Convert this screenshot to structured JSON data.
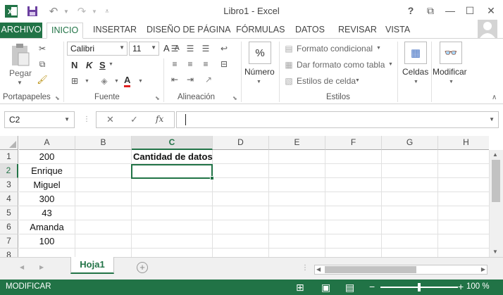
{
  "window": {
    "title": "Libro1 - Excel",
    "buttons": [
      "?",
      "⧉",
      "—",
      "☐",
      "✕"
    ]
  },
  "ribbon_tabs": [
    "ARCHIVO",
    "INICIO",
    "INSERTAR",
    "DISEÑO DE PÁGINA",
    "FÓRMULAS",
    "DATOS",
    "REVISAR",
    "VISTA"
  ],
  "clipboard": {
    "paste_label": "Pegar",
    "group_label": "Portapapeles"
  },
  "font": {
    "name": "Calibri",
    "size": "11",
    "bold": "N",
    "italic": "K",
    "underline": "S",
    "grow": "A",
    "shrink": "A",
    "color_letter": "A",
    "group_label": "Fuente"
  },
  "alignment": {
    "group_label": "Alineación"
  },
  "number": {
    "symbol": "%",
    "label": "Número"
  },
  "styles": {
    "conditional": "Formato condicional",
    "as_table": "Dar formato como tabla",
    "cell_styles": "Estilos de celda",
    "group_label": "Estilos"
  },
  "cells": {
    "label": "Celdas"
  },
  "editing": {
    "label": "Modificar"
  },
  "formula_bar": {
    "name_box": "C2",
    "fx": "fx",
    "value": ""
  },
  "grid": {
    "columns": [
      "A",
      "B",
      "C",
      "D",
      "E",
      "F",
      "G",
      "H"
    ],
    "rows": [
      "1",
      "2",
      "3",
      "4",
      "5",
      "6",
      "7",
      "8"
    ],
    "selected_column": "C",
    "selected_row": "2",
    "col_a": [
      "200",
      "Enrique",
      "Miguel",
      "300",
      "43",
      "Amanda",
      "100",
      ""
    ],
    "c1": "Cantidad de datos"
  },
  "sheets": {
    "active": "Hoja1"
  },
  "status": {
    "mode": "MODIFICAR",
    "zoom": "100 %"
  },
  "colors": {
    "accent": "#217346"
  }
}
